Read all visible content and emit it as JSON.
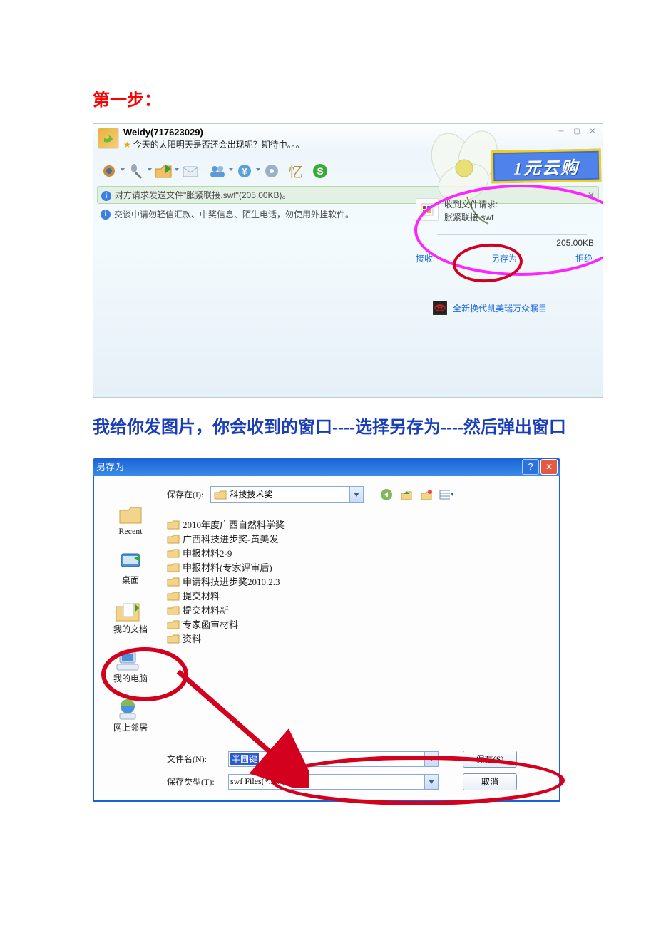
{
  "doc": {
    "step_title": "第一步：",
    "instruction": "我给你发图片，你会收到的窗口----选择另存为----然后弹出窗口"
  },
  "qq": {
    "user": "Weidy(717623029)",
    "status": "今天的太阳明天是否还会出现呢？期待中。。。",
    "bar1": "对方请求发送文件\"胀紧联接.swf\"(205.00KB)。",
    "bar2": "交谈中请勿轻信汇款、中奖信息、陌生电话，勿使用外挂软件。",
    "promo": "1元云购",
    "file_req_label": "收到文件请求:",
    "file_name": "胀紧联接.swf",
    "file_size": "205.00KB",
    "action_accept": "接收",
    "action_saveas": "另存为",
    "action_reject": "拒绝",
    "ad": "全新换代凯美瑞万众瞩目"
  },
  "saveas": {
    "title": "另存为",
    "save_in_label": "保存在(I):",
    "save_in_value": "科技技术奖",
    "places": {
      "recent": "Recent",
      "desktop": "桌面",
      "mydocs": "我的文档",
      "mypc": "我的电脑",
      "network": "网上邻居"
    },
    "folders": [
      "2010年度广西自然科学奖",
      "广西科技进步奖-黄美发",
      "申报材料2-9",
      "申报材料(专家评审后)",
      "申请科技进步奖2010.2.3",
      "提交材料",
      "提交材料新",
      "专家函审材料",
      "资料"
    ],
    "filename_label": "文件名(N):",
    "filename_value": "半圆键",
    "filetype_label": "保存类型(T):",
    "filetype_value": "swf Files(*.swf)",
    "save_btn": "保存(S)",
    "cancel_btn": "取消"
  }
}
